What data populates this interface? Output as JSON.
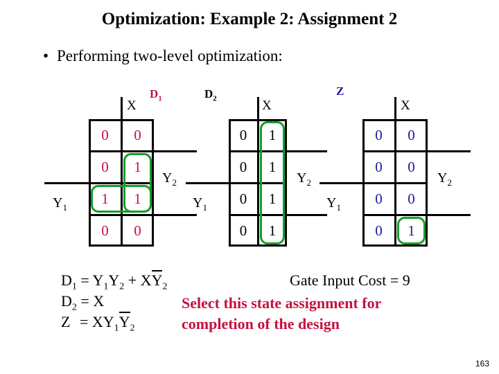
{
  "slide": {
    "title": "Optimization: Example 2: Assignment 2",
    "bullet": "Performing two-level optimization:",
    "bullet_marker": "•",
    "page_number": "163"
  },
  "colors": {
    "red": "#c4123f",
    "blue": "#1a1a9b",
    "black": "#000000",
    "group_green": "#1a9b28"
  },
  "kmaps": [
    {
      "name": "D",
      "name_sub": "1",
      "digit_color": "#c4123f",
      "label_color": "#c4123f",
      "col_var": "X",
      "row_var_right": "Y",
      "row_var_right_sub": "2",
      "row_var_left": "Y",
      "row_var_left_sub": "1",
      "cells": [
        [
          "0",
          "0"
        ],
        [
          "0",
          "1"
        ],
        [
          "1",
          "1"
        ],
        [
          "0",
          "0"
        ]
      ],
      "groups": [
        {
          "name": "group-col2-rows2-3",
          "col": 2,
          "row_start": 2,
          "row_span": 2,
          "col_span": 1
        },
        {
          "name": "group-row3-both-cols",
          "col": 1,
          "row_start": 3,
          "row_span": 1,
          "col_span": 2
        }
      ]
    },
    {
      "name": "D",
      "name_sub": "2",
      "digit_color": "#000000",
      "label_color": "#000000",
      "col_var": "X",
      "row_var_right": "Y",
      "row_var_right_sub": "2",
      "row_var_left": "Y",
      "row_var_left_sub": "1",
      "cells": [
        [
          "0",
          "1"
        ],
        [
          "0",
          "1"
        ],
        [
          "0",
          "1"
        ],
        [
          "0",
          "1"
        ]
      ],
      "groups": [
        {
          "name": "group-col2-all-rows",
          "col": 2,
          "row_start": 1,
          "row_span": 4,
          "col_span": 1
        }
      ]
    },
    {
      "name": "Z",
      "name_sub": "",
      "digit_color": "#1a1a9b",
      "label_color": "#1a1a9b",
      "col_var": "X",
      "row_var_right": "Y",
      "row_var_right_sub": "2",
      "row_var_left": "Y",
      "row_var_left_sub": "1",
      "cells": [
        [
          "0",
          "0"
        ],
        [
          "0",
          "0"
        ],
        [
          "0",
          "0"
        ],
        [
          "0",
          "1"
        ]
      ],
      "groups": [
        {
          "name": "group-row4-col2",
          "col": 2,
          "row_start": 4,
          "row_span": 1,
          "col_span": 1
        }
      ]
    }
  ],
  "equations": {
    "d1": {
      "lhs": "D",
      "lhs_sub": "1",
      "eq": "=",
      "t1": "Y",
      "t1_sub": "1",
      "t2": "Y",
      "t2_sub": "2",
      "plus": "+",
      "t3": "X",
      "t4_bar": "Y",
      "t4_sub": "2"
    },
    "d2": {
      "lhs": "D",
      "lhs_sub": "2",
      "eq": "=",
      "rhs": "X"
    },
    "z": {
      "lhs": "Z",
      "lhs_sub": "",
      "eq": "=",
      "t1": "X",
      "t2": "Y",
      "t2_sub": "1",
      "t3_bar": "Y",
      "t3_sub": "2"
    }
  },
  "notes": {
    "cost": "Gate Input Cost = 9",
    "select_line1": "Select this state assignment for",
    "select_line2": "completion of the design"
  }
}
